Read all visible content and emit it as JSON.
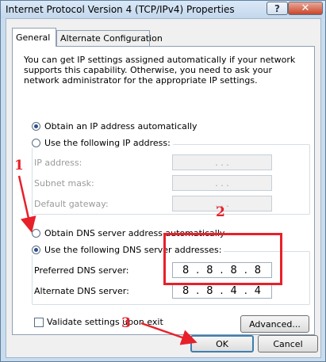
{
  "window": {
    "title": "Internet Protocol Version 4 (TCP/IPv4) Properties",
    "help_glyph": "?",
    "close_glyph": "✕"
  },
  "tabs": [
    {
      "label": "General",
      "active": true
    },
    {
      "label": "Alternate Configuration",
      "active": false
    }
  ],
  "intro_text": "You can get IP settings assigned automatically if your network supports this capability. Otherwise, you need to ask your network administrator for the appropriate IP settings.",
  "ip_section": {
    "auto_label": "Obtain an IP address automatically",
    "auto_selected": true,
    "manual_label": "Use the following IP address:",
    "manual_selected": false,
    "fields": [
      {
        "label": "IP address:",
        "value": ". . ."
      },
      {
        "label": "Subnet mask:",
        "value": ". . ."
      },
      {
        "label": "Default gateway:",
        "value": ". . ."
      }
    ]
  },
  "dns_section": {
    "auto_label": "Obtain DNS server address automatically",
    "auto_selected": false,
    "manual_label": "Use the following DNS server addresses:",
    "manual_selected": true,
    "preferred": {
      "label": "Preferred DNS server:",
      "octets": [
        "8",
        "8",
        "8",
        "8"
      ]
    },
    "alternate": {
      "label": "Alternate DNS server:",
      "octets": [
        "8",
        "8",
        "4",
        "4"
      ]
    }
  },
  "validate": {
    "label": "Validate settings upon exit",
    "checked": false
  },
  "buttons": {
    "advanced": "Advanced...",
    "ok": "OK",
    "cancel": "Cancel"
  },
  "annotations": {
    "num1": "1",
    "num2": "2",
    "num3": "3",
    "color": "#e8202a"
  }
}
